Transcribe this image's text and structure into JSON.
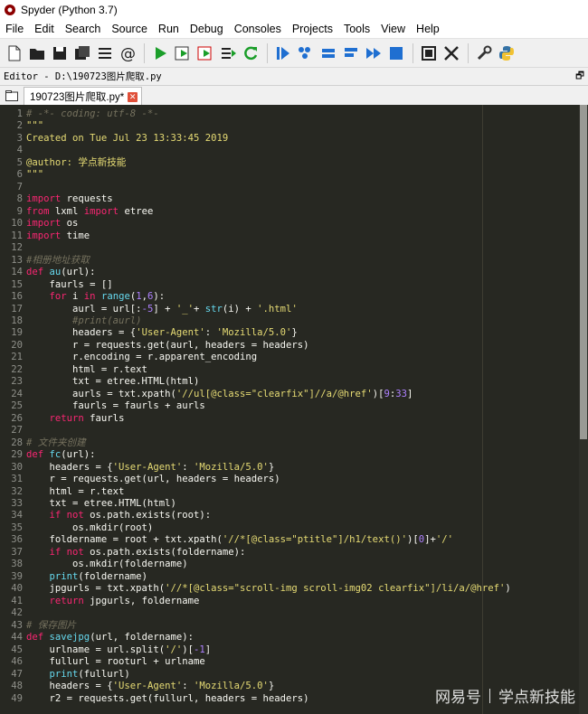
{
  "window": {
    "title": "Spyder (Python 3.7)"
  },
  "menu": [
    "File",
    "Edit",
    "Search",
    "Source",
    "Run",
    "Debug",
    "Consoles",
    "Projects",
    "Tools",
    "View",
    "Help"
  ],
  "editor": {
    "label": "Editor - D:\\190723图片爬取.py",
    "tab": "190723图片爬取.py*"
  },
  "colors": {
    "keyword": "#f92672",
    "string": "#e6db74",
    "comment": "#75715e",
    "number": "#ae81ff",
    "builtin": "#66d9ef",
    "default": "#f8f8f2",
    "background": "#272822"
  },
  "toolbar_icons": [
    "new-file-icon",
    "open-folder-icon",
    "save-icon",
    "save-all-icon",
    "list-icon",
    "at-icon",
    "run-icon",
    "run-cell-icon",
    "run-cell-advance-icon",
    "run-selection-icon",
    "rerun-icon",
    "debug-icon",
    "step-icon",
    "step-into-icon",
    "step-return-icon",
    "continue-icon",
    "stop-icon",
    "maximize-pane-icon",
    "fullscreen-icon",
    "preferences-icon",
    "python-path-icon"
  ],
  "code": [
    [
      [
        "comment",
        "# -*- coding: utf-8 -*-"
      ]
    ],
    [
      [
        "string",
        "\"\"\""
      ]
    ],
    [
      [
        "string",
        "Created on Tue Jul 23 13:33:45 2019"
      ]
    ],
    [
      [
        "string",
        ""
      ]
    ],
    [
      [
        "string",
        "@author: 学点新技能"
      ]
    ],
    [
      [
        "string",
        "\"\"\""
      ]
    ],
    [
      [
        "default",
        ""
      ]
    ],
    [
      [
        "keyword",
        "import"
      ],
      [
        "default",
        " requests"
      ]
    ],
    [
      [
        "keyword",
        "from"
      ],
      [
        "default",
        " lxml "
      ],
      [
        "keyword",
        "import"
      ],
      [
        "default",
        " etree"
      ]
    ],
    [
      [
        "keyword",
        "import"
      ],
      [
        "default",
        " os"
      ]
    ],
    [
      [
        "keyword",
        "import"
      ],
      [
        "default",
        " time"
      ]
    ],
    [
      [
        "default",
        ""
      ]
    ],
    [
      [
        "comment",
        "#相册地址获取"
      ]
    ],
    [
      [
        "keyword",
        "def"
      ],
      [
        "default",
        " "
      ],
      [
        "builtin",
        "au"
      ],
      [
        "default",
        "(url):"
      ]
    ],
    [
      [
        "default",
        "    faurls = []"
      ]
    ],
    [
      [
        "default",
        "    "
      ],
      [
        "keyword",
        "for"
      ],
      [
        "default",
        " i "
      ],
      [
        "keyword",
        "in"
      ],
      [
        "default",
        " "
      ],
      [
        "builtin",
        "range"
      ],
      [
        "default",
        "("
      ],
      [
        "number",
        "1"
      ],
      [
        "default",
        ","
      ],
      [
        "number",
        "6"
      ],
      [
        "default",
        "):"
      ]
    ],
    [
      [
        "default",
        "        aurl = url[:"
      ],
      [
        "number",
        "-5"
      ],
      [
        "default",
        "] + "
      ],
      [
        "string",
        "'_'"
      ],
      [
        "default",
        "+ "
      ],
      [
        "builtin",
        "str"
      ],
      [
        "default",
        "(i) + "
      ],
      [
        "string",
        "'.html'"
      ]
    ],
    [
      [
        "comment",
        "        #print(aurl)"
      ]
    ],
    [
      [
        "default",
        "        headers = {"
      ],
      [
        "string",
        "'User-Agent'"
      ],
      [
        "default",
        ": "
      ],
      [
        "string",
        "'Mozilla/5.0'"
      ],
      [
        "default",
        "}"
      ]
    ],
    [
      [
        "default",
        "        r = requests.get(aurl, headers = headers)"
      ]
    ],
    [
      [
        "default",
        "        r.encoding = r.apparent_encoding"
      ]
    ],
    [
      [
        "default",
        "        html = r.text"
      ]
    ],
    [
      [
        "default",
        "        txt = etree.HTML(html)"
      ]
    ],
    [
      [
        "default",
        "        aurls = txt.xpath("
      ],
      [
        "string",
        "'//ul[@class=\"clearfix\"]//a/@href'"
      ],
      [
        "default",
        ")["
      ],
      [
        "number",
        "9"
      ],
      [
        "default",
        ":"
      ],
      [
        "number",
        "33"
      ],
      [
        "default",
        "]"
      ]
    ],
    [
      [
        "default",
        "        faurls = faurls + aurls"
      ]
    ],
    [
      [
        "default",
        "    "
      ],
      [
        "keyword",
        "return"
      ],
      [
        "default",
        " faurls"
      ]
    ],
    [
      [
        "default",
        ""
      ]
    ],
    [
      [
        "comment",
        "# 文件夹创建"
      ]
    ],
    [
      [
        "keyword",
        "def"
      ],
      [
        "default",
        " "
      ],
      [
        "builtin",
        "fc"
      ],
      [
        "default",
        "(url):"
      ]
    ],
    [
      [
        "default",
        "    headers = {"
      ],
      [
        "string",
        "'User-Agent'"
      ],
      [
        "default",
        ": "
      ],
      [
        "string",
        "'Mozilla/5.0'"
      ],
      [
        "default",
        "}"
      ]
    ],
    [
      [
        "default",
        "    r = requests.get(url, headers = headers)"
      ]
    ],
    [
      [
        "default",
        "    html = r.text"
      ]
    ],
    [
      [
        "default",
        "    txt = etree.HTML(html)"
      ]
    ],
    [
      [
        "default",
        "    "
      ],
      [
        "keyword",
        "if not"
      ],
      [
        "default",
        " os.path.exists(root):"
      ]
    ],
    [
      [
        "default",
        "        os.mkdir(root)"
      ]
    ],
    [
      [
        "default",
        "    foldername = root + txt.xpath("
      ],
      [
        "string",
        "'//*[@class=\"ptitle\"]/h1/text()'"
      ],
      [
        "default",
        ")["
      ],
      [
        "number",
        "0"
      ],
      [
        "default",
        "]+"
      ],
      [
        "string",
        "'/'"
      ]
    ],
    [
      [
        "default",
        "    "
      ],
      [
        "keyword",
        "if not"
      ],
      [
        "default",
        " os.path.exists(foldername):"
      ]
    ],
    [
      [
        "default",
        "        os.mkdir(foldername)"
      ]
    ],
    [
      [
        "default",
        "    "
      ],
      [
        "builtin",
        "print"
      ],
      [
        "default",
        "(foldername)"
      ]
    ],
    [
      [
        "default",
        "    jpgurls = txt.xpath("
      ],
      [
        "string",
        "'//*[@class=\"scroll-img scroll-img02 clearfix\"]/li/a/@href'"
      ],
      [
        "default",
        ")"
      ]
    ],
    [
      [
        "default",
        "    "
      ],
      [
        "keyword",
        "return"
      ],
      [
        "default",
        " jpgurls, foldername"
      ]
    ],
    [
      [
        "default",
        ""
      ]
    ],
    [
      [
        "comment",
        "# 保存图片"
      ]
    ],
    [
      [
        "keyword",
        "def"
      ],
      [
        "default",
        " "
      ],
      [
        "builtin",
        "savejpg"
      ],
      [
        "default",
        "(url, foldername):"
      ]
    ],
    [
      [
        "default",
        "    urlname = url.split("
      ],
      [
        "string",
        "'/'"
      ],
      [
        "default",
        ")["
      ],
      [
        "number",
        "-1"
      ],
      [
        "default",
        "]"
      ]
    ],
    [
      [
        "default",
        "    fullurl = rooturl + urlname"
      ]
    ],
    [
      [
        "default",
        "    "
      ],
      [
        "builtin",
        "print"
      ],
      [
        "default",
        "(fullurl)"
      ]
    ],
    [
      [
        "default",
        "    headers = {"
      ],
      [
        "string",
        "'User-Agent'"
      ],
      [
        "default",
        ": "
      ],
      [
        "string",
        "'Mozilla/5.0'"
      ],
      [
        "default",
        "}"
      ]
    ],
    [
      [
        "default",
        "    r2 = requests.get(fullurl, headers = headers)"
      ]
    ]
  ],
  "watermark": {
    "brand": "网易号",
    "author": "学点新技能"
  }
}
